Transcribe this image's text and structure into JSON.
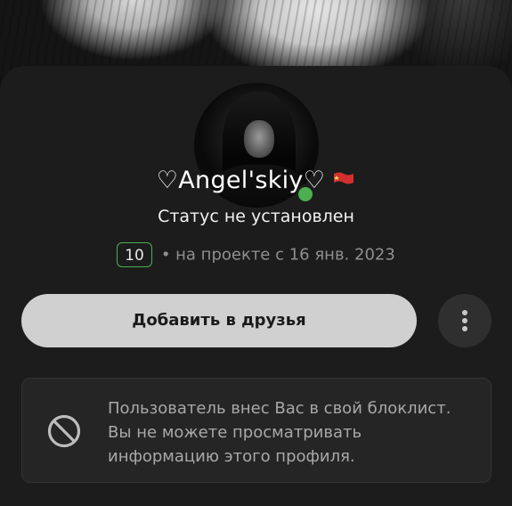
{
  "profile": {
    "name": "♡Angel'skiy♡",
    "flag_icon": "flag-icon",
    "status": "Статус не установлен",
    "level": "10",
    "member_since": "• на проекте с 16 янв. 2023",
    "online": true
  },
  "actions": {
    "add_friend_label": "Добавить в друзья",
    "more_icon": "more-vertical-icon"
  },
  "notice": {
    "icon": "blocked-icon",
    "text": "Пользователь внес Вас в свой блоклист. Вы не можете просматривать информацию этого профиля."
  },
  "colors": {
    "online": "#4caf50",
    "level_border": "#4caf50",
    "button_bg": "#d0d0d0",
    "card_bg": "#1c1c1c"
  }
}
